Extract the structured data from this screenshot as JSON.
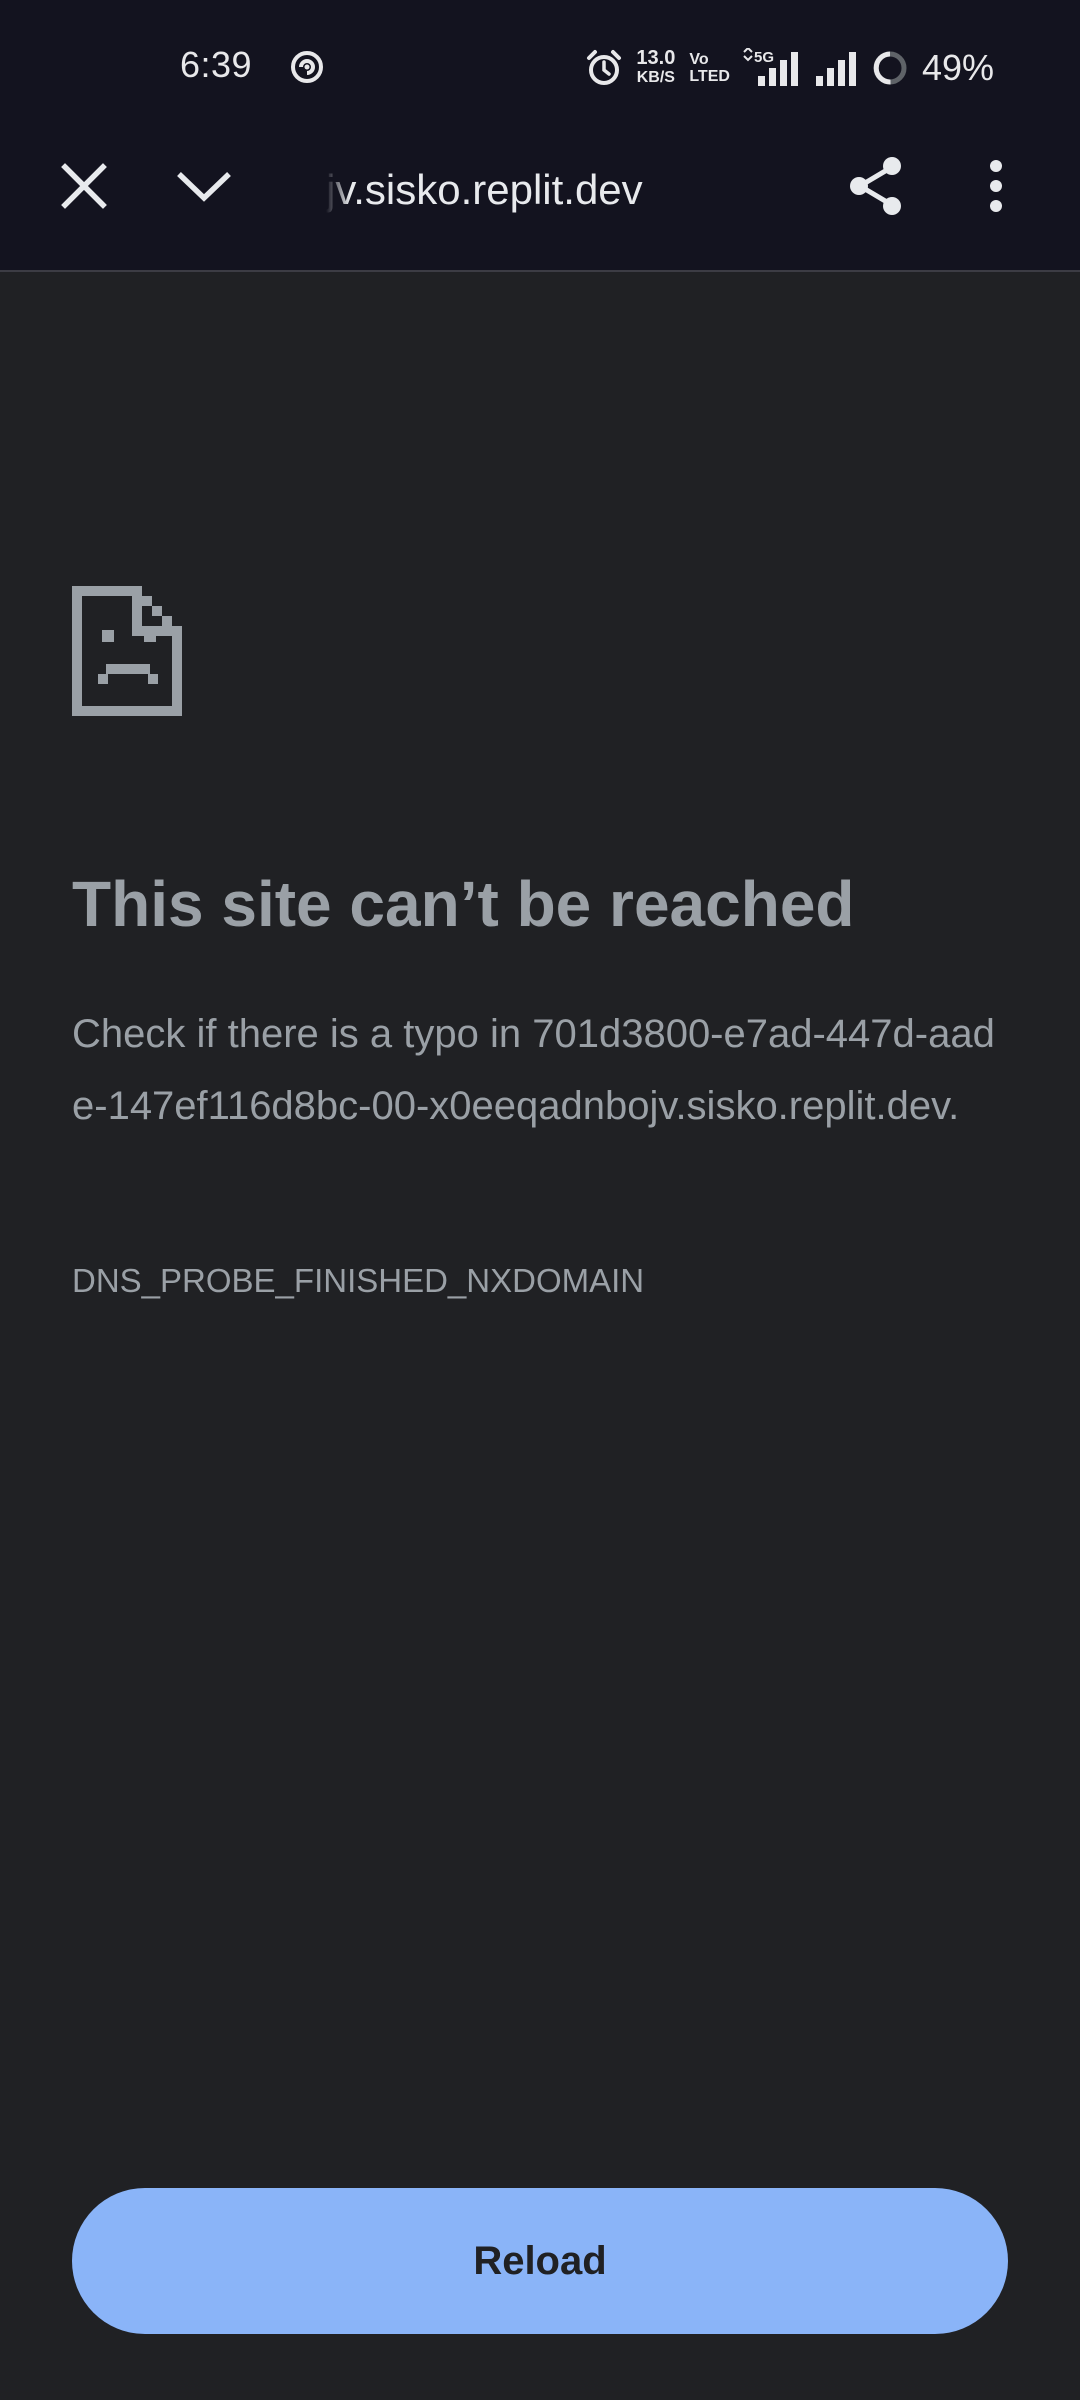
{
  "status_bar": {
    "time": "6:39",
    "net_speed_value": "13.0",
    "net_speed_unit": "KB/S",
    "volte_top": "Vo",
    "volte_bottom": "LTED",
    "network_type": "5G",
    "battery_percent": "49%",
    "icons": [
      "app-notification-icon",
      "alarm-icon",
      "data-arrows-icon",
      "signal-5g-icon",
      "signal-icon",
      "battery-ring-icon"
    ]
  },
  "toolbar": {
    "url": "jv.sisko.replit.dev",
    "icons": [
      "close-icon",
      "chevron-down-icon",
      "share-icon",
      "more-vert-icon"
    ]
  },
  "error": {
    "icon": "sad-page-icon",
    "title": "This site can’t be reached",
    "message": "Check if there is a typo in 701d3800-e7ad-447d-aade-147ef116d8bc-00-x0eeqadnbojv.sisko.replit.dev.",
    "code": "DNS_PROBE_FINISHED_NXDOMAIN"
  },
  "actions": {
    "reload_label": "Reload"
  },
  "colors": {
    "chrome_background": "#13131f",
    "page_background": "#202124",
    "text_muted": "#9aa0a6",
    "button_accent": "#8ab4f8"
  }
}
